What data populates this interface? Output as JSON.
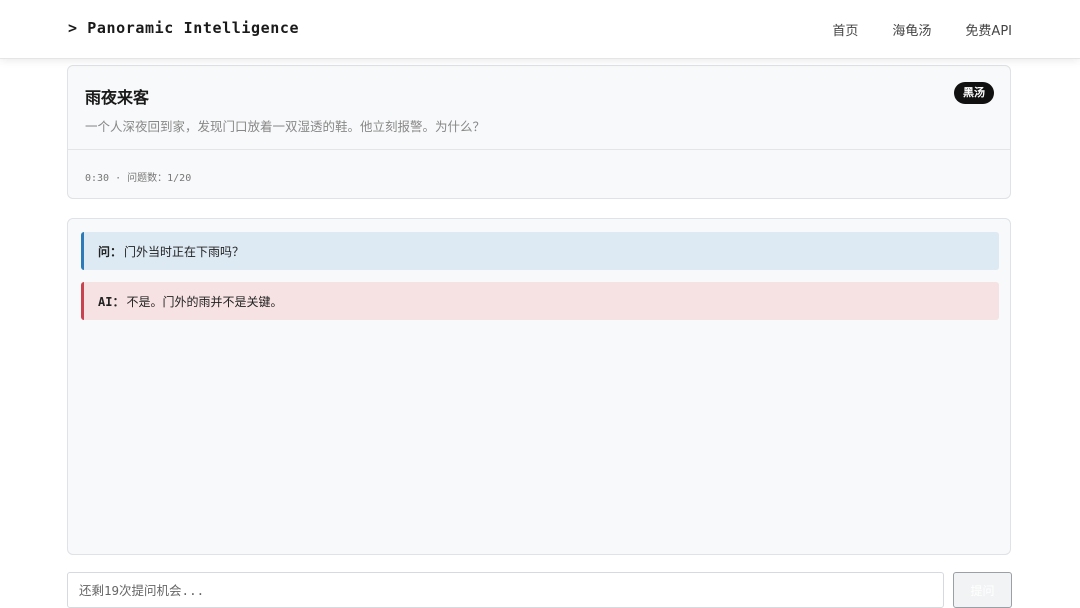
{
  "header": {
    "brand": "> Panoramic Intelligence",
    "nav": [
      {
        "label": "首页"
      },
      {
        "label": "海龟汤"
      },
      {
        "label": "免费API"
      }
    ]
  },
  "puzzle": {
    "title": "雨夜来客",
    "badge": "黑汤",
    "description": "一个人深夜回到家，发现门口放着一双湿透的鞋。他立刻报警。为什么？",
    "meta": "0:30 · 问题数：1/20"
  },
  "chat": {
    "messages": [
      {
        "role": "question",
        "prefix": "问：",
        "text": "门外当时正在下雨吗？"
      },
      {
        "role": "ai",
        "prefix": "AI：",
        "text": "不是。门外的雨并不是关键。"
      }
    ]
  },
  "input": {
    "placeholder": "还剩19次提问机会...",
    "value": "",
    "submit_label": "提问"
  },
  "colors": {
    "question_accent": "#2a7bb8",
    "question_bg": "#dde9f3",
    "ai_accent": "#c9424f",
    "ai_bg": "#f6e2e3",
    "badge_bg": "#111111"
  }
}
